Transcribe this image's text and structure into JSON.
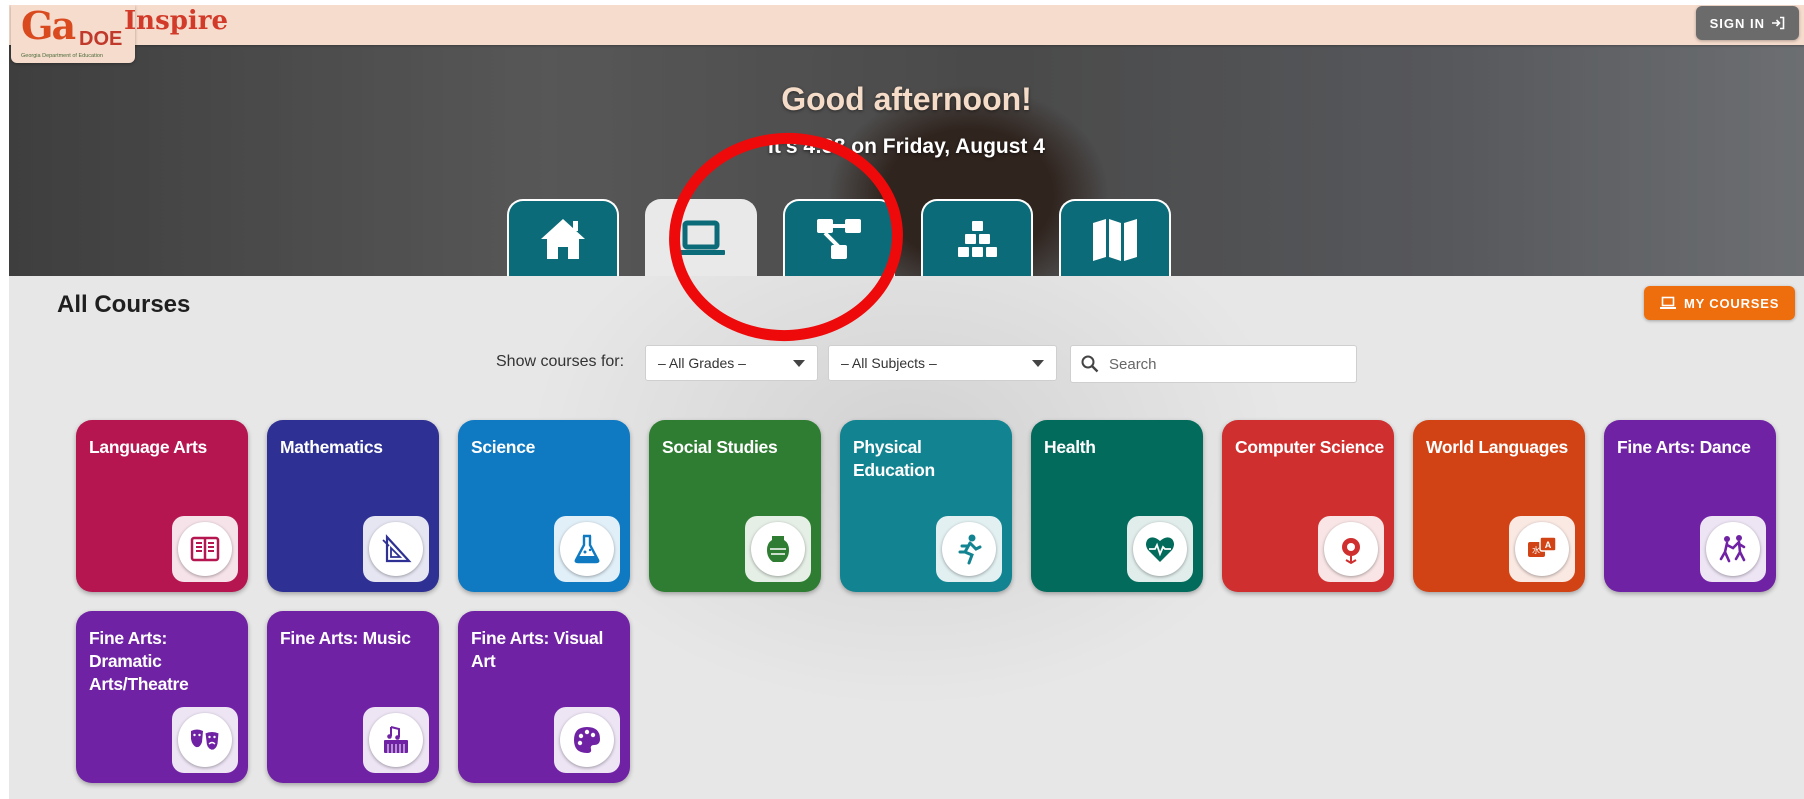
{
  "header": {
    "logo_text_ga": "Ga",
    "logo_text_doe": "DOE",
    "logo_subtitle": "Georgia Department of Education",
    "app_title": "Inspire",
    "signin_label": "SIGN IN"
  },
  "hero": {
    "greeting": "Good afternoon!",
    "datetime": "It's 4:38 on Friday, August 4",
    "tabs": [
      {
        "name": "home",
        "icon": "home-icon"
      },
      {
        "name": "courses",
        "icon": "laptop-icon",
        "active": true
      },
      {
        "name": "pathways",
        "icon": "flowchart-icon"
      },
      {
        "name": "resources",
        "icon": "blocks-icon"
      },
      {
        "name": "map",
        "icon": "map-icon"
      }
    ]
  },
  "main": {
    "section_title": "All Courses",
    "my_courses_label": "MY COURSES",
    "filter_label": "Show courses for:",
    "grades_select": "– All Grades –",
    "subjects_select": "– All Subjects –",
    "search_placeholder": "Search"
  },
  "courses": [
    {
      "title": "Language Arts",
      "color": "#b5164f",
      "icon": "book-icon"
    },
    {
      "title": "Mathematics",
      "color": "#2e3193",
      "icon": "protractor-icon"
    },
    {
      "title": "Science",
      "color": "#0f7ac2",
      "icon": "flask-icon"
    },
    {
      "title": "Social Studies",
      "color": "#2f7d32",
      "icon": "vase-icon"
    },
    {
      "title": "Physical Education",
      "color": "#128390",
      "icon": "runner-icon"
    },
    {
      "title": "Health",
      "color": "#026b5b",
      "icon": "heart-pulse-icon"
    },
    {
      "title": "Computer Science",
      "color": "#cf2f2f",
      "icon": "circuit-flower-icon"
    },
    {
      "title": "World Languages",
      "color": "#d14314",
      "icon": "translate-icon"
    },
    {
      "title": "Fine Arts: Dance",
      "color": "#6f22a3",
      "icon": "dancers-icon"
    },
    {
      "title": "Fine Arts: Dramatic Arts/Theatre",
      "color": "#6f22a3",
      "icon": "theatre-masks-icon"
    },
    {
      "title": "Fine Arts: Music",
      "color": "#6f22a3",
      "icon": "music-keyboard-icon"
    },
    {
      "title": "Fine Arts: Visual Art",
      "color": "#6f22a3",
      "icon": "palette-icon"
    }
  ],
  "colors": {
    "topbar": "#f6dccd",
    "tab": "#0b6b78",
    "my_courses": "#ee6d0c",
    "annotation_ring": "#ee0a0a"
  }
}
